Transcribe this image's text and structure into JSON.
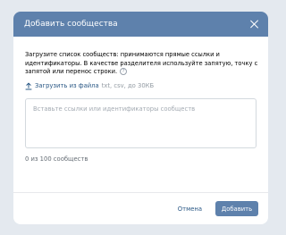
{
  "modal": {
    "title": "Добавить сообщества",
    "close_icon": "close-icon"
  },
  "body": {
    "description": "Загрузите список сообществ: принимаются прямые ссылки и идентификаторы. В качестве разделителя используйте запятую, точку с запятой или перенос строки.",
    "help_icon_symbol": "?",
    "upload": {
      "icon": "upload-icon",
      "label": "Загрузить из файла",
      "hint": "txt, csv, до 30КБ"
    },
    "textarea": {
      "placeholder": "Вставьте ссылки или идентификаторы сообществ",
      "value": ""
    },
    "counter": "0 из 100 сообществ"
  },
  "footer": {
    "cancel_label": "Отмена",
    "submit_label": "Добавить"
  },
  "colors": {
    "header_bg": "#5e81ac",
    "link": "#2a5885",
    "primary_button": "#5e81ac",
    "backdrop": "#e4e9ef"
  }
}
